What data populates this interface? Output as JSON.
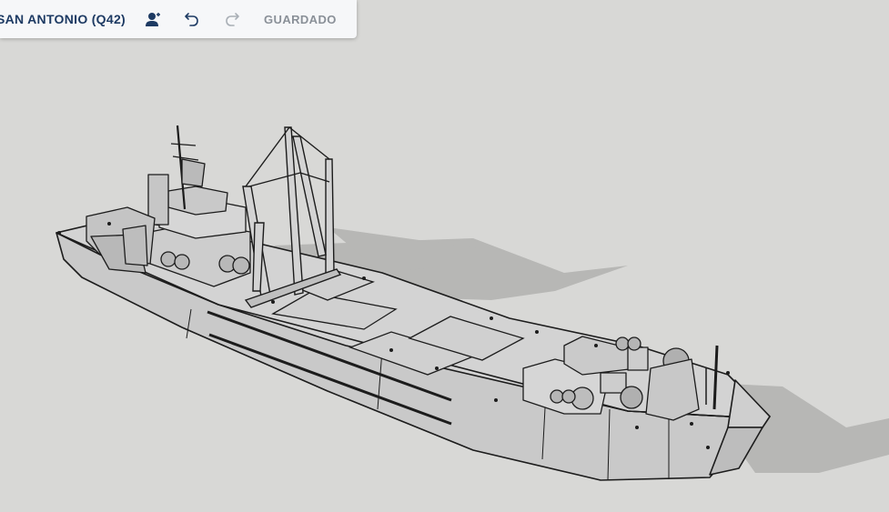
{
  "toolbar": {
    "model_title": "SAN ANTONIO (Q42)",
    "share_icon": "add-user-icon",
    "undo_icon": "undo-icon",
    "redo_icon": "redo-icon",
    "save_status": "GUARDADO"
  },
  "colors": {
    "canvas_background": "#d8d8d6",
    "toolbar_background": "#f6f7f9",
    "title_text": "#1d3a63",
    "status_text": "#8a9098",
    "icon_active": "#1d3a63",
    "icon_disabled": "#a9afb6"
  },
  "viewport": {
    "model": "ship-3d-model"
  }
}
